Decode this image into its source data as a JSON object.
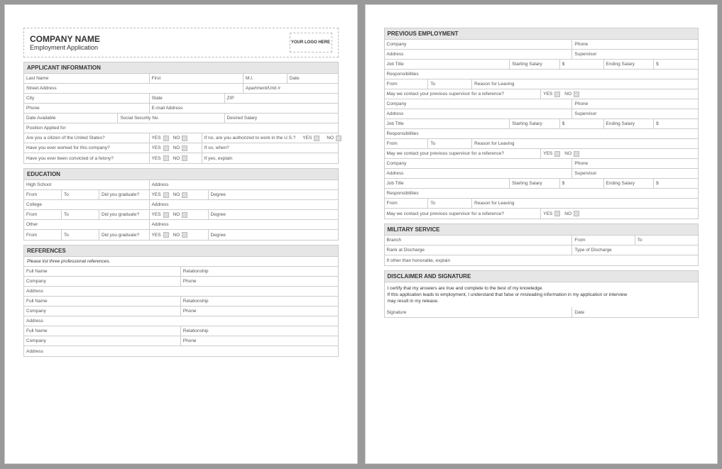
{
  "header": {
    "company": "COMPANY NAME",
    "subtitle": "Employment Application",
    "logo": "YOUR LOGO HERE"
  },
  "sections": {
    "applicant": "APPLICANT INFORMATION",
    "education": "EDUCATION",
    "references": "REFERENCES",
    "previous": "PREVIOUS EMPLOYMENT",
    "military": "MILITARY SERVICE",
    "disclaimer": "DISCLAIMER  AND SIGNATURE"
  },
  "labels": {
    "lastName": "Last Name",
    "first": "First",
    "mi": "M.I.",
    "date": "Date",
    "streetAddress": "Street Address",
    "apt": "Apartment/Unit #",
    "city": "City",
    "state": "State",
    "zip": "ZIP",
    "phone": "Phone",
    "email": "E-mail Address",
    "dateAvailable": "Date Available",
    "ssn": "Social Security No.",
    "desiredSalary": "Desired Salary",
    "positionApplied": "Position Applied for",
    "citizen": "Are you a citizen of the United States?",
    "yes": "YES",
    "no": "NO",
    "authorized": "If no, are you authorized to work in the U.S.?",
    "workedBefore": "Have you ever worked for this company?",
    "ifSoWhen": "If so, when?",
    "felony": "Have you ever been convicted of a felony?",
    "ifYesExplain": "If yes, explain",
    "highSchool": "High School",
    "address": "Address",
    "from": "From",
    "to": "To",
    "didGraduate": "Did you graduate?",
    "degree": "Degree",
    "college": "College",
    "other": "Other",
    "refsNote": "Please list three professional references.",
    "fullName": "Full Name",
    "relationship": "Relationship",
    "company": "Company",
    "supervisor": "Supervisor",
    "jobTitle": "Job Title",
    "startingSalary": "Starting Salary",
    "dollar": "$",
    "endingSalary": "Ending Salary",
    "responsibilities": "Responsibilities",
    "reasonLeaving": "Reason for Leaving",
    "mayContact": "May we contact your previous supervisor for a reference?",
    "branch": "Branch",
    "rankDischarge": "Rank at Discharge",
    "typeDischarge": "Type of Discharge",
    "otherHonorable": "If other than honorable, explain",
    "disc1": "I certify that my answers are true and complete to the best of my knowledge.",
    "disc2": "If this application leads to employment, I understand that false or misleading information in my application or interview",
    "disc3": "may result in my release.",
    "signature": "Signature"
  }
}
